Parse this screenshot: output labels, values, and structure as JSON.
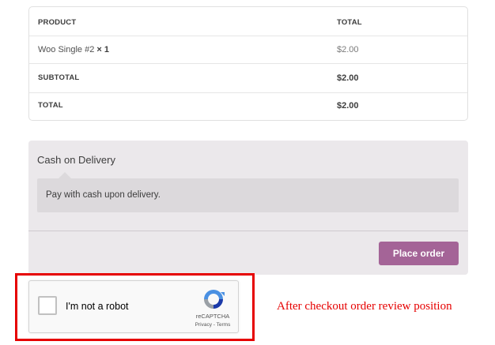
{
  "order_review": {
    "headers": {
      "product": "PRODUCT",
      "total": "TOTAL"
    },
    "item": {
      "name": "Woo Single #2",
      "quantity": "× 1",
      "total": "$2.00"
    },
    "subtotal": {
      "label": "SUBTOTAL",
      "value": "$2.00"
    },
    "total": {
      "label": "TOTAL",
      "value": "$2.00"
    }
  },
  "payment": {
    "method_title": "Cash on Delivery",
    "method_description": "Pay with cash upon delivery.",
    "place_order_label": "Place order"
  },
  "recaptcha": {
    "checkbox_label": "I'm not a robot",
    "brand": "reCAPTCHA",
    "links": "Privacy - Terms"
  },
  "annotation": {
    "caption": "After checkout order review position",
    "highlight_color": "#e60000"
  },
  "colors": {
    "accent_button": "#a46497",
    "payment_background": "#ebe8eb",
    "description_background": "#dcd9dc"
  },
  "icons": [
    "recaptcha-logo-icon"
  ]
}
